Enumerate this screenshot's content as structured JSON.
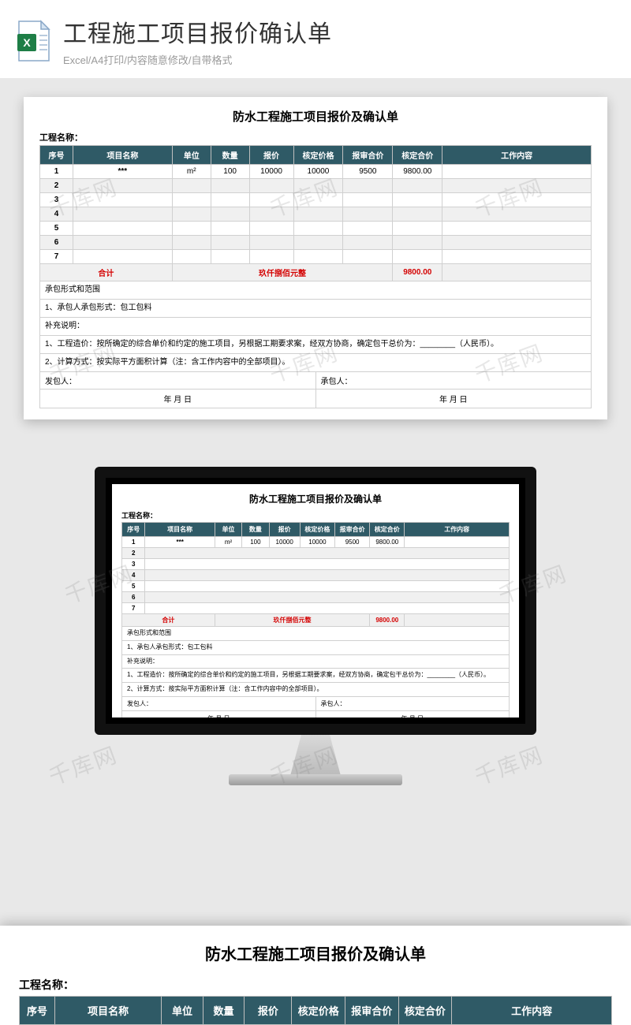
{
  "header": {
    "title": "工程施工项目报价确认单",
    "subtitle": "Excel/A4打印/内容随意修改/自带格式"
  },
  "watermark": "千库网",
  "doc": {
    "title": "防水工程施工项目报价及确认单",
    "project_label": "工程名称：",
    "columns": [
      "序号",
      "项目名称",
      "单位",
      "数量",
      "报价",
      "核定价格",
      "报审合价",
      "核定合价",
      "工作内容"
    ],
    "rows": [
      {
        "no": "1",
        "name": "***",
        "unit": "m²",
        "qty": "100",
        "quote": "10000",
        "approved_price": "10000",
        "audit_total": "9500",
        "approved_total": "9800.00",
        "content": ""
      },
      {
        "no": "2"
      },
      {
        "no": "3"
      },
      {
        "no": "4"
      },
      {
        "no": "5"
      },
      {
        "no": "6"
      },
      {
        "no": "7"
      }
    ],
    "total_label": "合计",
    "total_text": "玖仟捌佰元整",
    "total_value": "9800.00",
    "scope_header": "承包形式和范围",
    "scope_line1": "1、承包人承包形式：包工包料",
    "supplement_header": "补充说明：",
    "supp_line1": "1、工程造价：按所确定的综合单价和约定的施工项目，另根据工期要求案，经双方协商，确定包干总价为：________（人民币）。",
    "supp_line2": "2、计算方式：按实际平方面积计算（注：含工作内容中的全部项目）。",
    "issuer_label": "发包人：",
    "contractor_label": "承包人：",
    "date_text": "年  月  日"
  }
}
